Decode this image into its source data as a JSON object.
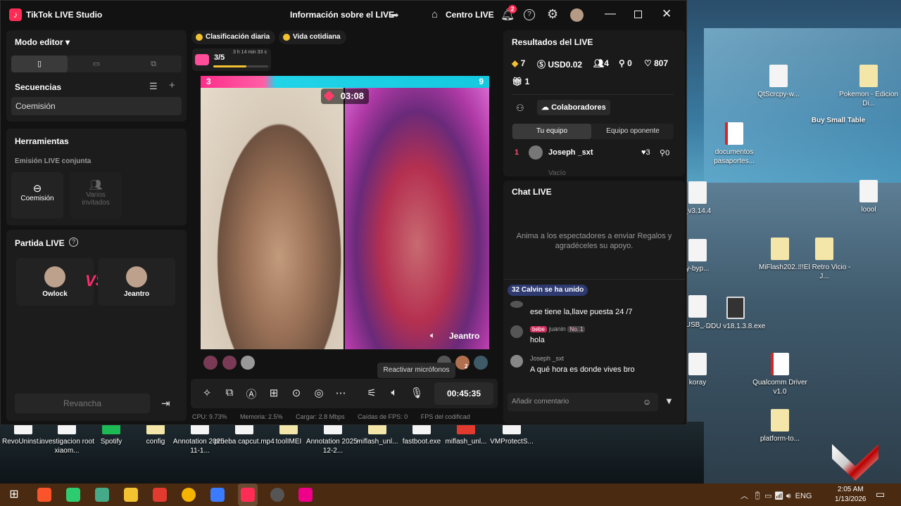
{
  "app": {
    "title": "TikTok LIVE Studio",
    "live_info": "Información sobre el LIVE",
    "centro_live": "Centro LIVE",
    "notification_count": "2",
    "help_glyph": "?"
  },
  "editor": {
    "modo_editor": "Modo editor ▾",
    "secuencias": "Secuencias",
    "sequence_item": "Coemisión"
  },
  "tools": {
    "title": "Herramientas",
    "section": "Emisión LIVE conjunta",
    "items": [
      {
        "label": "Coemisión"
      },
      {
        "label": "Varios invitados"
      }
    ]
  },
  "partida": {
    "title": "Partida LIVE",
    "player1": "Owlock",
    "player2": "Jeantro",
    "vs": "VS",
    "revancha": "Revancha"
  },
  "chips": {
    "daily": "Clasificación diaria",
    "daily_life": "Vida cotidiana"
  },
  "goal": {
    "count": "3/5",
    "time": "3 h 14 min 33 s",
    "progress": 0.6
  },
  "battle": {
    "score_left": "3",
    "score_right": "9",
    "timer": "03:08",
    "right_name": "Jeantro",
    "viewer_count": "2"
  },
  "controls": {
    "live_timer": "00:45:35",
    "tooltip": "Reactivar micrófonos"
  },
  "stats": {
    "cpu": "CPU: 9.73%",
    "mem": "Memoria: 2.5%",
    "load": "Cargar: 2.8 Mbps",
    "fps_drop": "Caídas de FPS: 0",
    "fps_enc": "FPS del codificad"
  },
  "results": {
    "title": "Resultados del LIVE",
    "diamonds": "7",
    "usd": "USD0.02",
    "users": "4",
    "new_users": "0",
    "likes": "807",
    "gifts": "1",
    "collab": "Colaboradores",
    "tab_mine": "Tu equipo",
    "tab_opp": "Equipo oponente",
    "rank1": {
      "pos": "1",
      "name": "Joseph _sxt",
      "hearts": "3",
      "other": "0"
    },
    "rank2_partial": "Vacío"
  },
  "chat": {
    "title": "Chat LIVE",
    "empty": "Anima a los espectadores a enviar Regalos y agradéceles su apoyo.",
    "joined": "32  Calvin se ha unido",
    "messages": [
      {
        "user": "",
        "text": "ese tiene la,llave puesta 24 /7"
      },
      {
        "user": "juanin",
        "badge": "bebe",
        "rank": "No. 1",
        "text": "hola"
      },
      {
        "user": "Joseph _sxt",
        "text": "A qué hora es donde vives bro"
      }
    ],
    "placeholder": "Añadir comentario"
  },
  "desktop_icons": [
    {
      "label": "QtScrcpy-w..."
    },
    {
      "label": "Pokemon - Edicion Di..."
    },
    {
      "label": "documentos pasaportes..."
    },
    {
      "label": "_v3.14.4"
    },
    {
      "label": "loool"
    },
    {
      "label": "y-byp..."
    },
    {
      "label": "MiFlash202..."
    },
    {
      "label": "!!!El Retro Vicio - J..."
    },
    {
      "label": "USB_..."
    },
    {
      "label": "DDU v18.1.3.8.exe"
    },
    {
      "label": "koray"
    },
    {
      "label": "Qualcomm Driver v1.0"
    },
    {
      "label": "platform-to..."
    },
    {
      "label": "Buy Small Table"
    },
    {
      "label": "RevoUninst..."
    },
    {
      "label": "investigacion root xiaom..."
    },
    {
      "label": "Spotify"
    },
    {
      "label": "config"
    },
    {
      "label": "Annotation 2025-11-1..."
    },
    {
      "label": "prueba capcut.mp4"
    },
    {
      "label": "toolIMEI"
    },
    {
      "label": "Annotation 2025-12-2..."
    },
    {
      "label": "miflash_unl..."
    },
    {
      "label": "fastboot.exe"
    },
    {
      "label": "miflash_unl..."
    },
    {
      "label": "VMProtectS..."
    }
  ],
  "taskbar": {
    "lang": "ENG",
    "time": "2:05 AM",
    "date": "1/13/2026"
  }
}
